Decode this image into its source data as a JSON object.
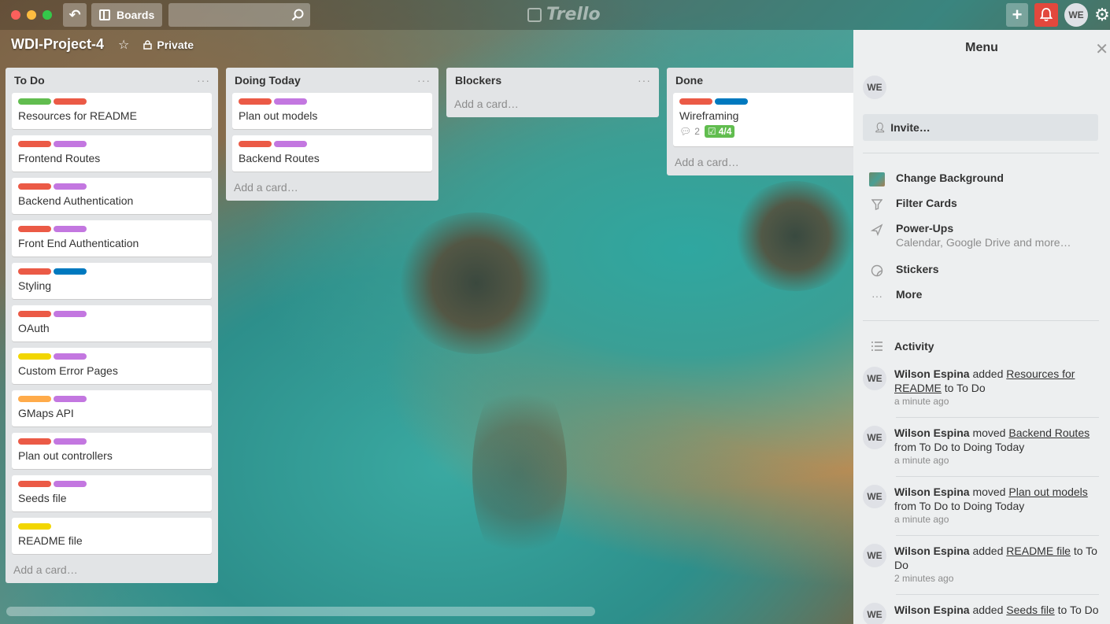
{
  "header": {
    "boards_label": "Boards",
    "search_value": "",
    "logo_text": "Trello",
    "avatar_initials": "WE"
  },
  "board": {
    "title": "WDI-Project-4",
    "privacy": "Private"
  },
  "colors": {
    "green": "#61bd4f",
    "red": "#eb5a46",
    "purple": "#c377e0",
    "blue": "#0079bf",
    "yellow": "#f2d600",
    "orange": "#ffab4a",
    "notification": "#e2483d"
  },
  "lists": [
    {
      "title": "To Do",
      "add_card": "Add a card…",
      "cards": [
        {
          "title": "Resources for README",
          "labels": [
            "green",
            "red"
          ]
        },
        {
          "title": "Frontend Routes",
          "labels": [
            "red",
            "purple"
          ]
        },
        {
          "title": "Backend Authentication",
          "labels": [
            "red",
            "purple"
          ]
        },
        {
          "title": "Front End Authentication",
          "labels": [
            "red",
            "purple"
          ]
        },
        {
          "title": "Styling",
          "labels": [
            "red",
            "blue"
          ]
        },
        {
          "title": "OAuth",
          "labels": [
            "red",
            "purple"
          ]
        },
        {
          "title": "Custom Error Pages",
          "labels": [
            "yellow",
            "purple"
          ]
        },
        {
          "title": "GMaps API",
          "labels": [
            "orange",
            "purple"
          ]
        },
        {
          "title": "Plan out controllers",
          "labels": [
            "red",
            "purple"
          ]
        },
        {
          "title": "Seeds file",
          "labels": [
            "red",
            "purple"
          ]
        },
        {
          "title": "README file",
          "labels": [
            "yellow"
          ]
        }
      ]
    },
    {
      "title": "Doing Today",
      "add_card": "Add a card…",
      "cards": [
        {
          "title": "Plan out models",
          "labels": [
            "red",
            "purple"
          ]
        },
        {
          "title": "Backend Routes",
          "labels": [
            "red",
            "purple"
          ]
        }
      ]
    },
    {
      "title": "Blockers",
      "add_card": "Add a card…",
      "cards": []
    },
    {
      "title": "Done",
      "add_card": "Add a card…",
      "cards": [
        {
          "title": "Wireframing",
          "labels": [
            "red",
            "blue"
          ],
          "comments": "2",
          "checklist": "4/4"
        }
      ]
    }
  ],
  "menu": {
    "title": "Menu",
    "member_initials": "WE",
    "invite_label": "Invite…",
    "items": [
      {
        "label": "Change Background",
        "icon": "background-swatch-icon"
      },
      {
        "label": "Filter Cards",
        "icon": "filter-icon"
      },
      {
        "label": "Power-Ups",
        "sub": "Calendar, Google Drive and more…",
        "icon": "rocket-icon"
      },
      {
        "label": "Stickers",
        "icon": "sticker-icon"
      },
      {
        "label": "More",
        "icon": "more-icon"
      }
    ],
    "activity_title": "Activity",
    "activity": [
      {
        "user": "Wilson Espina",
        "action": "added",
        "link": "Resources for README",
        "rest": "to To Do",
        "time": "a minute ago"
      },
      {
        "user": "Wilson Espina",
        "action": "moved",
        "link": "Backend Routes",
        "rest": "from To Do to Doing Today",
        "time": "a minute ago"
      },
      {
        "user": "Wilson Espina",
        "action": "moved",
        "link": "Plan out models",
        "rest": "from To Do to Doing Today",
        "time": "a minute ago"
      },
      {
        "user": "Wilson Espina",
        "action": "added",
        "link": "README file",
        "rest": "to To Do",
        "time": "2 minutes ago"
      },
      {
        "user": "Wilson Espina",
        "action": "added",
        "link": "Seeds file",
        "rest": "to To Do",
        "time": ""
      }
    ]
  }
}
